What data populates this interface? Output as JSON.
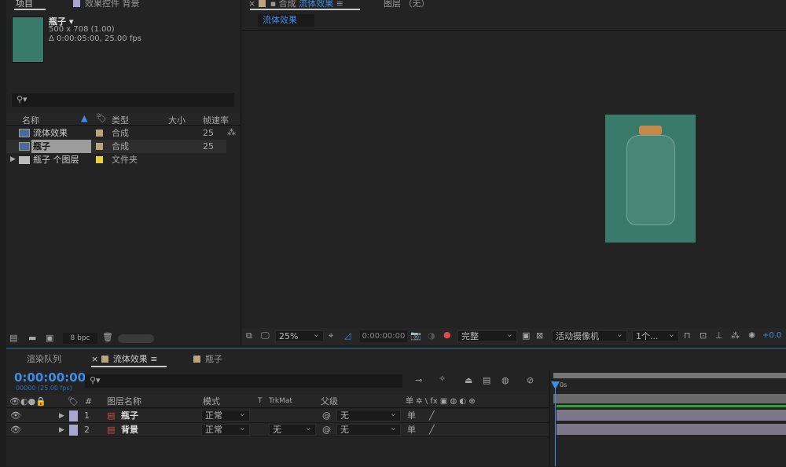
{
  "project_panel": {
    "tabs": [
      "项目",
      "效果控件 背景"
    ],
    "preview": {
      "name": "瓶子 ▾",
      "dimensions": "500 x 708 (1.00)",
      "duration": "Δ 0:00:05:00, 25.00 fps"
    },
    "search_placeholder": "",
    "columns": [
      "名称",
      "类型",
      "大小",
      "帧速率"
    ],
    "items": [
      {
        "name": "流体效果",
        "type": "合成",
        "fps": "25",
        "label_color": "#b9a47b"
      },
      {
        "name": "瓶子",
        "type": "合成",
        "fps": "25",
        "label_color": "#b9a47b",
        "selected": true
      },
      {
        "name": "瓶子 个图层",
        "type": "文件夹",
        "fps": "",
        "label_color": "#e6d23c"
      }
    ],
    "bpc": "8 bpc"
  },
  "comp_panel": {
    "tab_label": "合成",
    "tab_name": "流体效果",
    "layer_tab": "图层 （无）",
    "breadcrumb": "流体效果",
    "toolbar": {
      "zoom": "25%",
      "timecode": "0:00:00:00",
      "resolution": "完整",
      "camera": "活动摄像机",
      "views": "1个...",
      "exposure": "+0.0"
    },
    "canvas_color": "#3a7a6a"
  },
  "timeline": {
    "tabs": [
      "渲染队列",
      "流体效果",
      "瓶子"
    ],
    "timecode": "0:00:00:00",
    "frame_info": "00000 (25.00 fps)",
    "columns": {
      "number": "#",
      "name": "图层名称",
      "mode": "模式",
      "t": "T",
      "trkmat": "TrkMat",
      "parent": "父级",
      "switches": "单 ✲ \\ fx ▣ ◍ ◐ ⊕"
    },
    "ruler_label": "0s",
    "layers": [
      {
        "num": "1",
        "name": "瓶子",
        "mode": "正常",
        "trkmat": "",
        "parent": "无",
        "label_color": "#a9a6d0"
      },
      {
        "num": "2",
        "name": "背景",
        "mode": "正常",
        "trkmat": "无",
        "parent": "无",
        "label_color": "#a9a6d0"
      }
    ],
    "accent": "#3d8ee6",
    "workarea_color": "#2fa32f"
  }
}
